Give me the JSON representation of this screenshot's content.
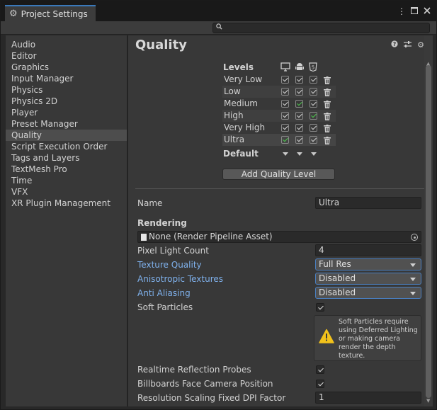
{
  "window": {
    "tab_title": "Project Settings",
    "controls": [
      "more-icon",
      "maximize-icon",
      "close-icon"
    ]
  },
  "search": {
    "placeholder": ""
  },
  "sidebar": {
    "items": [
      {
        "label": "Audio"
      },
      {
        "label": "Editor"
      },
      {
        "label": "Graphics"
      },
      {
        "label": "Input Manager"
      },
      {
        "label": "Physics"
      },
      {
        "label": "Physics 2D"
      },
      {
        "label": "Player"
      },
      {
        "label": "Preset Manager"
      },
      {
        "label": "Quality",
        "selected": true
      },
      {
        "label": "Script Execution Order"
      },
      {
        "label": "Tags and Layers"
      },
      {
        "label": "TextMesh Pro"
      },
      {
        "label": "Time"
      },
      {
        "label": "VFX"
      },
      {
        "label": "XR Plugin Management"
      }
    ]
  },
  "main": {
    "title": "Quality",
    "header_icons": [
      "help-icon",
      "preset-icon",
      "settings-icon"
    ],
    "levels": {
      "label": "Levels",
      "platforms": [
        "standalone-icon",
        "android-icon",
        "html5-icon"
      ],
      "rows": [
        {
          "name": "Very Low",
          "checks": [
            "white",
            "white",
            "white"
          ]
        },
        {
          "name": "Low",
          "checks": [
            "white",
            "white",
            "white"
          ]
        },
        {
          "name": "Medium",
          "checks": [
            "white",
            "green",
            "white"
          ]
        },
        {
          "name": "High",
          "checks": [
            "white",
            "white",
            "green"
          ]
        },
        {
          "name": "Very High",
          "checks": [
            "white",
            "white",
            "white"
          ]
        },
        {
          "name": "Ultra",
          "checks": [
            "green",
            "white",
            "white"
          ]
        }
      ],
      "default_label": "Default",
      "add_button": "Add Quality Level"
    },
    "name_label": "Name",
    "name_value": "Ultra",
    "rendering_label": "Rendering",
    "render_pipeline_value": "None (Render Pipeline Asset)",
    "pixel_light_count_label": "Pixel Light Count",
    "pixel_light_count_value": "4",
    "texture_quality_label": "Texture Quality",
    "texture_quality_value": "Full Res",
    "anisotropic_label": "Anisotropic Textures",
    "anisotropic_value": "Disabled",
    "anti_aliasing_label": "Anti Aliasing",
    "anti_aliasing_value": "Disabled",
    "soft_particles_label": "Soft Particles",
    "soft_particles_warning": "Soft Particles require using Deferred Lighting or making camera render the depth texture.",
    "realtime_reflection_label": "Realtime Reflection Probes",
    "billboards_label": "Billboards Face Camera Position",
    "resolution_scaling_label": "Resolution Scaling Fixed DPI Factor",
    "resolution_scaling_value": "1"
  },
  "colors": {
    "accent": "#3a79bb",
    "link_label": "#7fb1ec",
    "check_green": "#4ec94e",
    "warning_yellow": "#f2c21b"
  }
}
